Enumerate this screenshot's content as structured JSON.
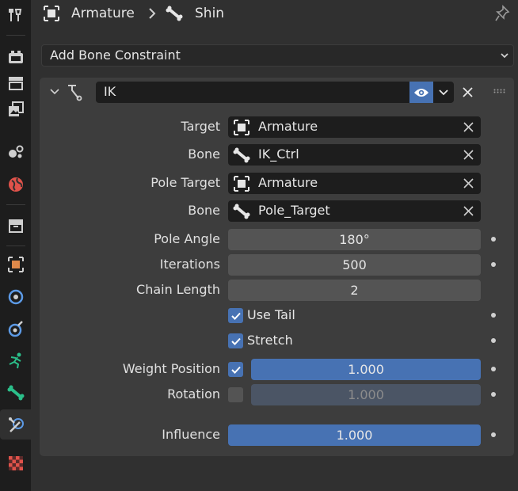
{
  "sidebar": {
    "tabs": [
      {
        "icon": "tool-icon",
        "color": "#cfcfcf"
      },
      {
        "icon": "render-icon",
        "color": "#cfcfcf"
      },
      {
        "icon": "output-icon",
        "color": "#cfcfcf"
      },
      {
        "icon": "view-layer-icon",
        "color": "#cfcfcf"
      },
      {
        "icon": "scene-icon",
        "color": "#cfcfcf"
      },
      {
        "icon": "world-icon",
        "color": "#e0524a"
      },
      {
        "icon": "collection-icon",
        "color": "#cfcfcf"
      },
      {
        "icon": "object-icon",
        "color": "#e0894a"
      },
      {
        "icon": "modifier-icon",
        "color": "#5c9ae6"
      },
      {
        "icon": "particles-icon",
        "color": "#5c9ae6"
      },
      {
        "icon": "physics-icon",
        "color": "#2bbf8a"
      },
      {
        "icon": "bone-data-icon",
        "color": "#2bbf8a"
      },
      {
        "icon": "bone-constraint-icon",
        "color": "#5c9ae6"
      },
      {
        "icon": "texture-icon",
        "color": "#e0524a"
      }
    ]
  },
  "header": {
    "object": "Armature",
    "bone": "Shin"
  },
  "add_constraint": {
    "label": "Add Bone Constraint"
  },
  "constraint": {
    "name": "IK",
    "target_label": "Target",
    "target_value": "Armature",
    "bone_label": "Bone",
    "bone_value": "IK_Ctrl",
    "pole_target_label": "Pole Target",
    "pole_target_value": "Armature",
    "pole_bone_label": "Bone",
    "pole_bone_value": "Pole_Target",
    "pole_angle_label": "Pole Angle",
    "pole_angle_value": "180°",
    "iterations_label": "Iterations",
    "iterations_value": "500",
    "chain_length_label": "Chain Length",
    "chain_length_value": "2",
    "use_tail_label": "Use Tail",
    "use_tail": true,
    "stretch_label": "Stretch",
    "stretch": true,
    "weight_position_label": "Weight Position",
    "weight_position_enabled": true,
    "weight_position_value": "1.000",
    "rotation_label": "Rotation",
    "rotation_enabled": false,
    "rotation_value": "1.000",
    "influence_label": "Influence",
    "influence_value": "1.000"
  },
  "colors": {
    "accent": "#4772b3",
    "panel": "#3d3d3d",
    "background": "#303030"
  }
}
